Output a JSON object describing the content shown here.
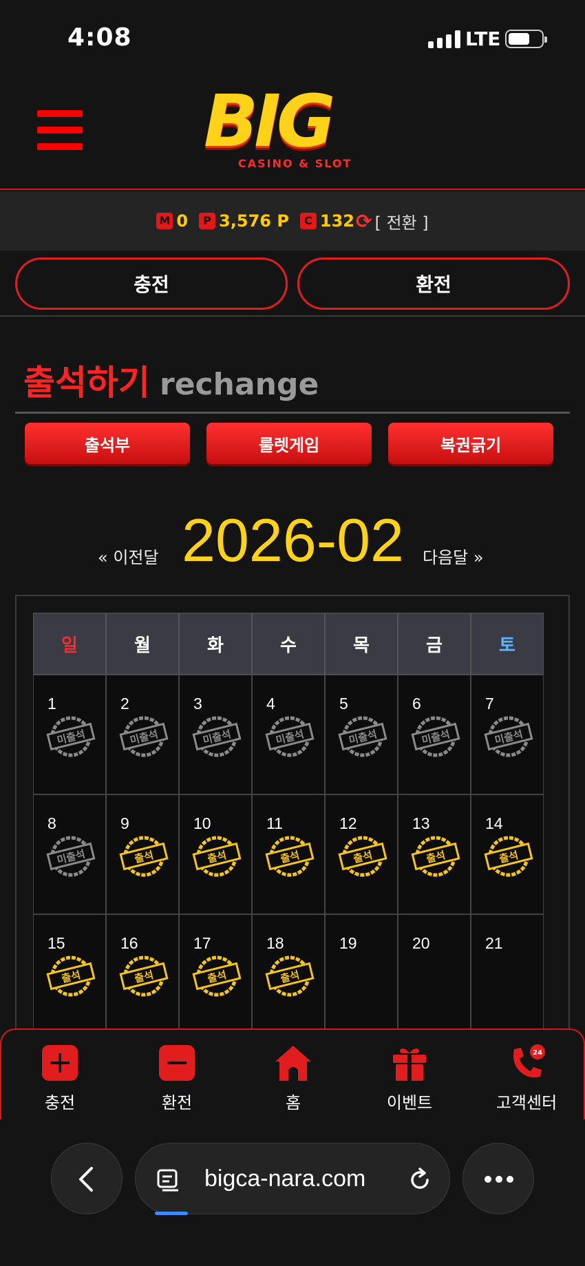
{
  "status_bar": {
    "time": "4:08",
    "network": "LTE"
  },
  "header": {
    "logo_text": "BIG",
    "logo_sub": "CASINO & SLOT"
  },
  "balance": {
    "money_tag": "M",
    "money_value": "0",
    "point_tag": "P",
    "point_value": "3,576 P",
    "coin_tag": "C",
    "coin_value": "132",
    "switch_label": "[ 전환 ]"
  },
  "actions": {
    "charge_label": "충전",
    "exchange_label": "환전"
  },
  "section": {
    "title_ko": "출석하기",
    "title_en": "rechange"
  },
  "tabs": [
    "출석부",
    "룰렛게임",
    "복권긁기"
  ],
  "calendar": {
    "prev_label": "« 이전달",
    "month": "2026-02",
    "next_label": "다음달 »",
    "weekdays": [
      "일",
      "월",
      "화",
      "수",
      "목",
      "금",
      "토"
    ],
    "stamp_absent": "미출석",
    "stamp_present": "출석",
    "weeks": [
      [
        {
          "day": "1",
          "status": "absent"
        },
        {
          "day": "2",
          "status": "absent"
        },
        {
          "day": "3",
          "status": "absent"
        },
        {
          "day": "4",
          "status": "absent"
        },
        {
          "day": "5",
          "status": "absent"
        },
        {
          "day": "6",
          "status": "absent"
        },
        {
          "day": "7",
          "status": "absent"
        }
      ],
      [
        {
          "day": "8",
          "status": "absent"
        },
        {
          "day": "9",
          "status": "present"
        },
        {
          "day": "10",
          "status": "present"
        },
        {
          "day": "11",
          "status": "present"
        },
        {
          "day": "12",
          "status": "present"
        },
        {
          "day": "13",
          "status": "present"
        },
        {
          "day": "14",
          "status": "present"
        }
      ],
      [
        {
          "day": "15",
          "status": "present"
        },
        {
          "day": "16",
          "status": "present"
        },
        {
          "day": "17",
          "status": "present"
        },
        {
          "day": "18",
          "status": "present"
        },
        {
          "day": "19",
          "status": "none"
        },
        {
          "day": "20",
          "status": "none"
        },
        {
          "day": "21",
          "status": "none"
        }
      ]
    ]
  },
  "bottom_nav": [
    {
      "label": "충전",
      "icon": "plus-icon"
    },
    {
      "label": "환전",
      "icon": "minus-icon"
    },
    {
      "label": "홈",
      "icon": "home-icon"
    },
    {
      "label": "이벤트",
      "icon": "gift-icon"
    },
    {
      "label": "고객센터",
      "icon": "phone-24-icon"
    }
  ],
  "browser": {
    "url": "bigca-nara.com"
  },
  "colors": {
    "accent_red": "#e11d1d",
    "gold": "#ffd21a",
    "background": "#141414"
  }
}
